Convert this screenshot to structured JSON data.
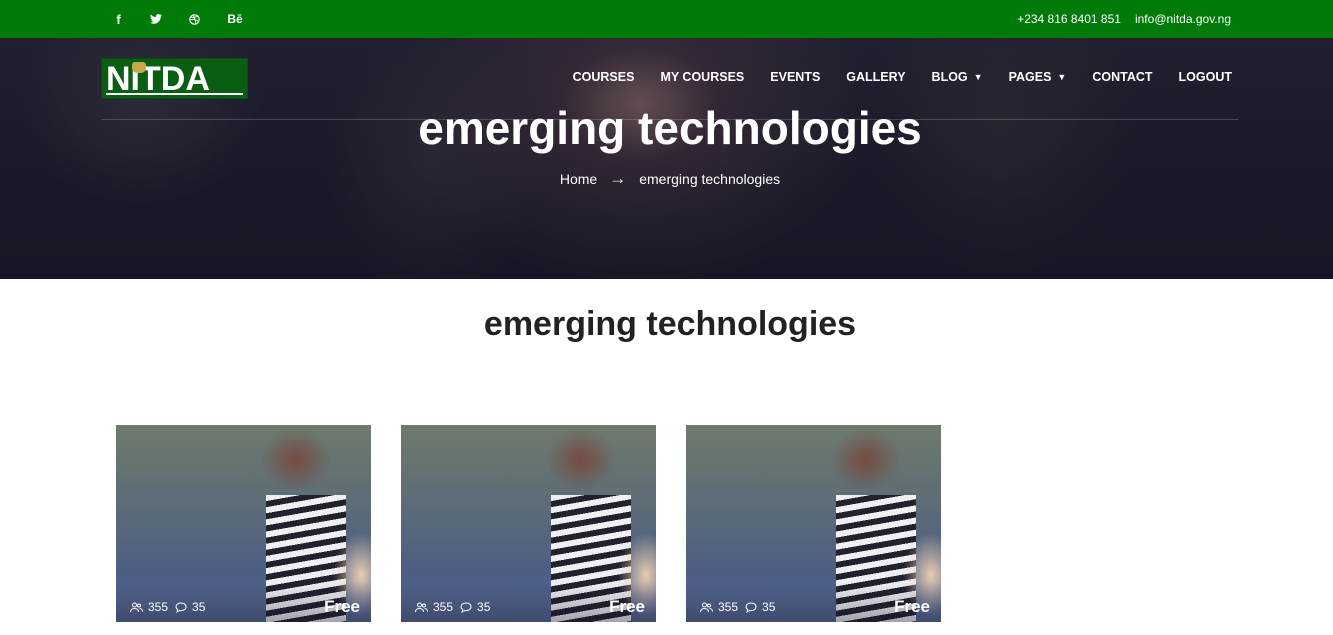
{
  "topbar": {
    "social": [
      {
        "icon": "facebook-icon",
        "glyph": "f"
      },
      {
        "icon": "twitter-icon",
        "glyph": ""
      },
      {
        "icon": "dribbble-icon",
        "glyph": ""
      },
      {
        "icon": "behance-icon",
        "glyph": "Bē"
      }
    ],
    "phone": "+234 816 8401 851",
    "email": "info@nitda.gov.ng",
    "bg_color": "#007b0a"
  },
  "header": {
    "logo_text": "NITDA",
    "nav": [
      {
        "label": "COURSES",
        "has_dropdown": false
      },
      {
        "label": "MY COURSES",
        "has_dropdown": false
      },
      {
        "label": "EVENTS",
        "has_dropdown": false
      },
      {
        "label": "GALLERY",
        "has_dropdown": false
      },
      {
        "label": "BLOG",
        "has_dropdown": true
      },
      {
        "label": "PAGES",
        "has_dropdown": true
      },
      {
        "label": "CONTACT",
        "has_dropdown": false
      },
      {
        "label": "LOGOUT",
        "has_dropdown": false
      }
    ]
  },
  "hero": {
    "title": "emerging technologies",
    "breadcrumb": {
      "home": "Home",
      "arrow": "→",
      "current": "emerging technologies"
    }
  },
  "main": {
    "title": "emerging technologies",
    "courses": [
      {
        "students": "355",
        "comments": "35",
        "price": "Free"
      },
      {
        "students": "355",
        "comments": "35",
        "price": "Free"
      },
      {
        "students": "355",
        "comments": "35",
        "price": "Free"
      }
    ]
  }
}
